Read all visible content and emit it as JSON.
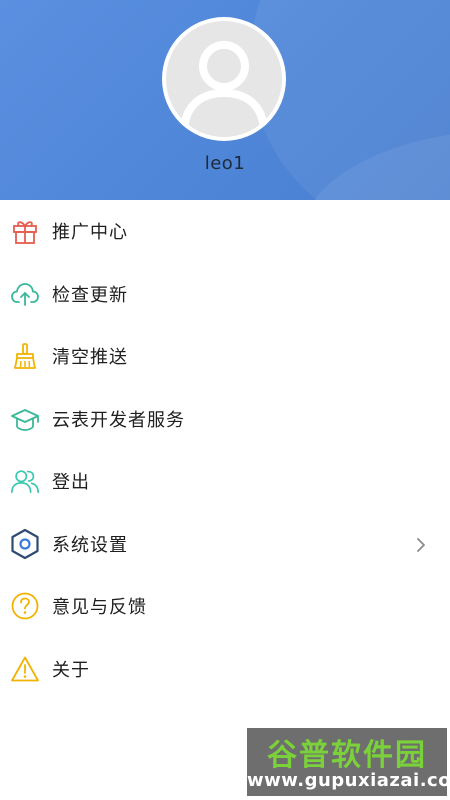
{
  "profile": {
    "username": "leo1",
    "avatar_icon": "person-avatar-icon"
  },
  "menu": [
    {
      "label": "推广中心",
      "icon": "gift-icon",
      "color": "#e55d4e"
    },
    {
      "label": "检查更新",
      "icon": "cloud-upload-icon",
      "color": "#3bb79a"
    },
    {
      "label": "清空推送",
      "icon": "broom-icon",
      "color": "#f0b400"
    },
    {
      "label": "云表开发者服务",
      "icon": "graduation-cap-icon",
      "color": "#3bb79a"
    },
    {
      "label": "登出",
      "icon": "users-icon",
      "color": "#3bc7b0"
    },
    {
      "label": "系统设置",
      "icon": "hexagon-settings-icon",
      "color": "#2f4a70",
      "has_arrow": true
    },
    {
      "label": "意见与反馈",
      "icon": "question-circle-icon",
      "color": "#f0b400"
    },
    {
      "label": "关于",
      "icon": "warning-triangle-icon",
      "color": "#f0b400"
    }
  ],
  "watermark": {
    "title": "谷普软件园",
    "url": "www.gupuxiazai.com"
  },
  "colors": {
    "header_gradient_start": "#5b8fe0",
    "header_gradient_end": "#4a7fd0"
  }
}
